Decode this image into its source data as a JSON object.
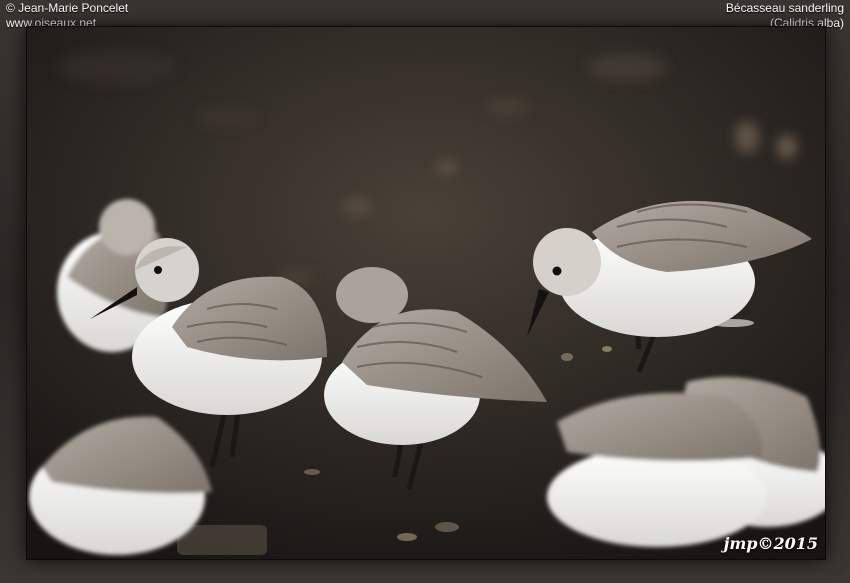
{
  "header": {
    "copyright": "© Jean-Marie Poncelet",
    "website": "www.oiseaux.net",
    "species_fr": "Bécasseau sanderling",
    "species_latin": "(Calidris alba)"
  },
  "photo": {
    "signature": "jmp©2015",
    "palette": {
      "sand_dark": "#1d1916",
      "sand_mid": "#3a332d",
      "belly": "#f2f2f0",
      "back": "#9d948c",
      "head": "#c9c4be",
      "leg": "#1a1714"
    }
  }
}
